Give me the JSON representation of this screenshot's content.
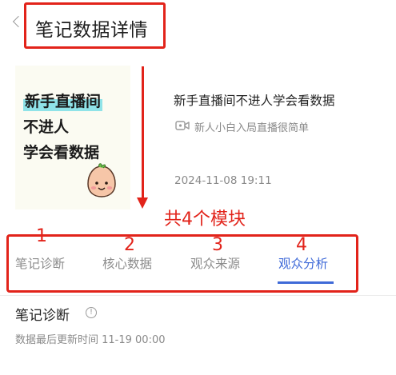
{
  "header": {
    "title": "笔记数据详情"
  },
  "note": {
    "cover_lines": [
      "新手直播间",
      "不进人",
      "学会看数据"
    ],
    "title": "新手直播间不进人学会看数据",
    "subtitle": "新人小白入局直播很简单",
    "date": "2024-11-08 19:11"
  },
  "annotation": {
    "text": "共4个模块",
    "color": "#e2231a"
  },
  "tabs": [
    {
      "number": "1",
      "label": "笔记诊断",
      "active": false
    },
    {
      "number": "2",
      "label": "核心数据",
      "active": false
    },
    {
      "number": "3",
      "label": "观众来源",
      "active": false
    },
    {
      "number": "4",
      "label": "观众分析",
      "active": true
    }
  ],
  "section": {
    "title": "笔记诊断",
    "update_time": "数据最后更新时间 11-19 00:00"
  },
  "colors": {
    "accent": "#3f6ad8",
    "annotation_red": "#e2231a"
  },
  "icons": {
    "back": "chevron-left-icon",
    "video": "video-camera-icon",
    "info": "info-circle-icon"
  }
}
